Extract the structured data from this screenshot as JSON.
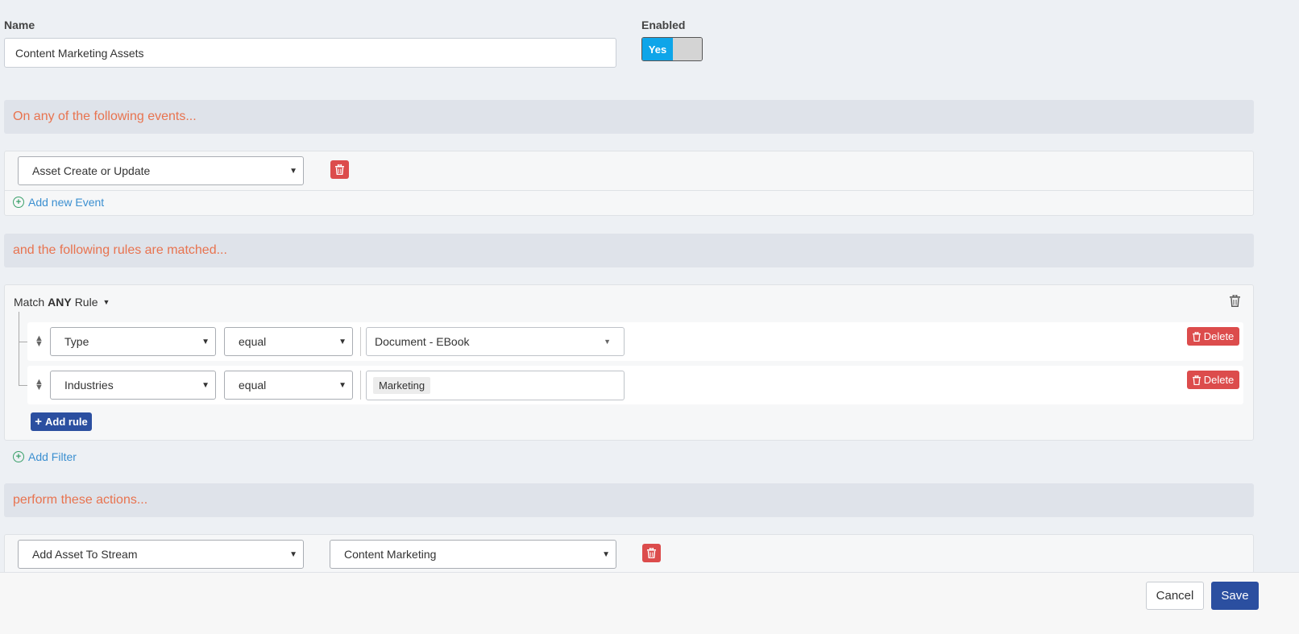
{
  "name_field": {
    "label": "Name",
    "value": "Content Marketing Assets"
  },
  "enabled_toggle": {
    "label": "Enabled",
    "on_label": "Yes"
  },
  "events_section": {
    "title": "On any of the following events..."
  },
  "events": {
    "selected": "Asset Create or Update",
    "add_link": "Add new Event"
  },
  "rules_section": {
    "title": "and the following rules are matched..."
  },
  "rules": {
    "match_prefix": "Match",
    "match_mode": "ANY",
    "match_suffix": "Rule",
    "rows": [
      {
        "field": "Type",
        "operator": "equal",
        "value": "Document - EBook",
        "delete_label": "Delete"
      },
      {
        "field": "Industries",
        "operator": "equal",
        "value": "Marketing",
        "delete_label": "Delete"
      }
    ],
    "add_rule_label": "Add rule",
    "add_filter_link": "Add Filter"
  },
  "actions_section": {
    "title": "perform these actions..."
  },
  "actions": {
    "action": "Add Asset To Stream",
    "target": "Content Marketing"
  },
  "footer": {
    "cancel_label": "Cancel",
    "save_label": "Save"
  },
  "colors": {
    "accent": "#e8734f",
    "primary": "#2b4fa0",
    "danger": "#dc4c4c",
    "toggle_on": "#0ea5e9",
    "link": "#3b8fd0"
  }
}
